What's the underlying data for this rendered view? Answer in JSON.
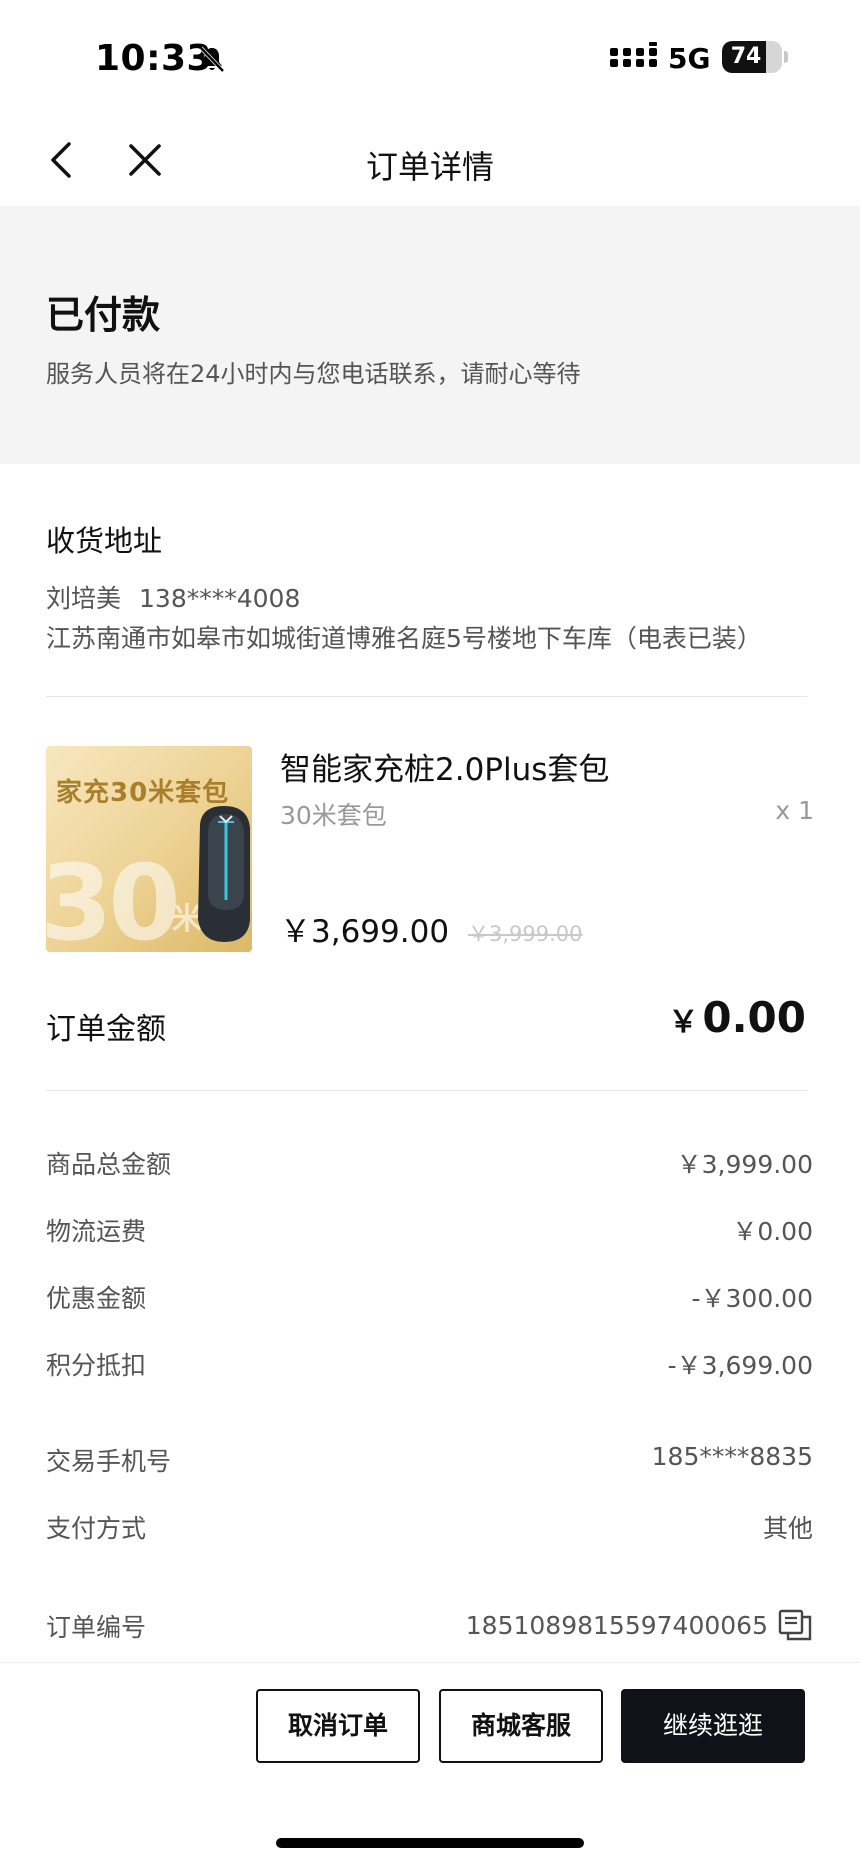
{
  "status_bar": {
    "time": "10:33",
    "network": "5G",
    "battery_percent": 74,
    "battery_label": "74"
  },
  "nav": {
    "title": "订单详情"
  },
  "order_status": {
    "title": "已付款",
    "description": "服务人员将在24小时内与您电话联系，请耐心等待"
  },
  "address": {
    "title": "收货地址",
    "name": "刘培美",
    "phone": "138****4008",
    "line": "江苏南通市如皋市如城街道博雅名庭5号楼地下车库（电表已装）"
  },
  "product": {
    "image_caption": "家充30米套包",
    "image_big_number": "30",
    "image_unit": "米",
    "name": "智能家充桩2.0Plus套包",
    "spec": "30米套包",
    "quantity": "x 1",
    "price": "￥3,699.00",
    "original_price": "￥3,999.00"
  },
  "order_amount": {
    "label": "订单金额",
    "currency": "￥",
    "value": "0.00"
  },
  "summary": {
    "goods_total_label": "商品总金额",
    "goods_total_value": "￥3,999.00",
    "shipping_label": "物流运费",
    "shipping_value": "￥0.00",
    "discount_label": "优惠金额",
    "discount_value": "-￥300.00",
    "points_label": "积分抵扣",
    "points_value": "-￥3,699.00"
  },
  "details": {
    "phone_label": "交易手机号",
    "phone_value": "185****8835",
    "payment_label": "支付方式",
    "payment_value": "其他",
    "order_no_label": "订单编号",
    "order_no_value": "1851089815597400065"
  },
  "actions": {
    "cancel_label": "取消订单",
    "service_label": "商城客服",
    "continue_label": "继续逛逛"
  },
  "icons": {
    "back": "chevron-left-icon",
    "close": "close-icon",
    "bell": "bell-slash-icon",
    "copy": "copy-icon"
  },
  "colors": {
    "primary_button": "#0f1219",
    "status_block_bg": "#f4f4f4"
  }
}
